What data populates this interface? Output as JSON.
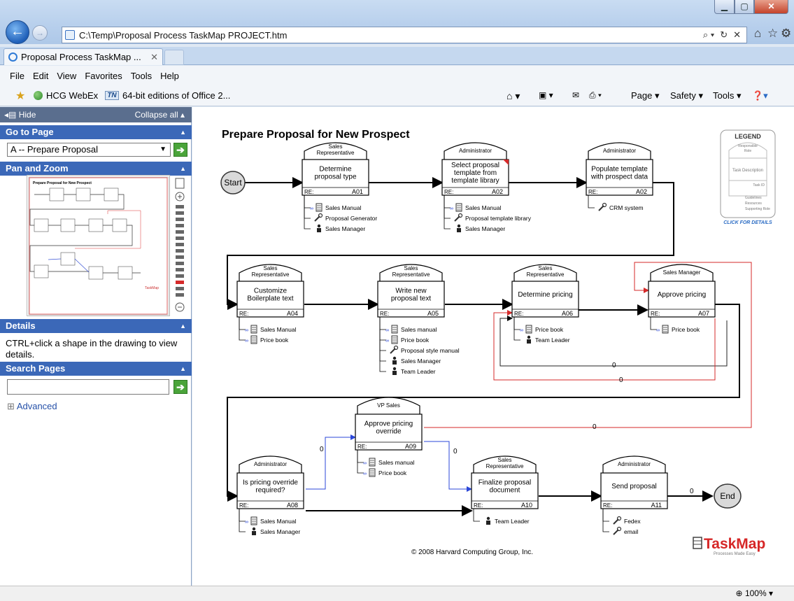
{
  "browser": {
    "address": "C:\\Temp\\Proposal Process TaskMap PROJECT.htm",
    "tab_title": "Proposal Process TaskMap ...",
    "tab_close": "✕",
    "menu": [
      "File",
      "Edit",
      "View",
      "Favorites",
      "Tools",
      "Help"
    ],
    "favorites": [
      "HCG WebEx",
      "64-bit editions of Office 2..."
    ],
    "commands": [
      "Page ▾",
      "Safety ▾",
      "Tools ▾"
    ],
    "zoom": "100%",
    "icons": [
      "back-icon",
      "forward-icon",
      "home-icon",
      "favorites-star-icon",
      "settings-gear-icon",
      "feeds-icon",
      "mail-icon",
      "print-icon",
      "help-icon"
    ]
  },
  "sidebar": {
    "hide": "Hide",
    "collapse_all": "Collapse all",
    "goto_header": "Go to Page",
    "goto_value": "A -- Prepare Proposal",
    "pan_zoom_header": "Pan and Zoom",
    "details_header": "Details",
    "details_text": "CTRL+click a shape in the drawing to view details.",
    "search_header": "Search Pages",
    "advanced": "Advanced"
  },
  "diagram": {
    "title": "Prepare Proposal for New Prospect",
    "start": "Start",
    "end": "End",
    "re_label": "RE:",
    "copyright": "© 2008 Harvard Computing Group, Inc.",
    "logo": "TaskMap",
    "logo_tag": "Processes Made Easy",
    "legend": {
      "title": "LEGEND",
      "role": [
        "Responsible",
        "Role"
      ],
      "desc": "Task Description",
      "id": "Task ID",
      "items": [
        "Guidelines",
        "Resources",
        "Supporting Role"
      ],
      "click": "CLICK FOR DETAILS"
    },
    "tasks": [
      {
        "id": "A01",
        "role": [
          "Sales",
          "Representative"
        ],
        "desc": [
          "Determine",
          "proposal type"
        ],
        "items": [
          [
            "doc",
            "Sales Manual"
          ],
          [
            "tool",
            "Proposal Generator"
          ],
          [
            "person",
            "Sales Manager"
          ]
        ]
      },
      {
        "id": "A02",
        "role": [
          "Administrator"
        ],
        "desc": [
          "Select proposal",
          "template from",
          "template library"
        ],
        "items": [
          [
            "doc",
            "Sales Manual"
          ],
          [
            "tool",
            "Proposal template library"
          ],
          [
            "person",
            "Sales Manager"
          ]
        ]
      },
      {
        "id": "A02",
        "role": [
          "Administrator"
        ],
        "desc": [
          "Populate template",
          "with prospect data"
        ],
        "items": [
          [
            "tool",
            "CRM system"
          ]
        ]
      },
      {
        "id": "A04",
        "role": [
          "Sales",
          "Representative"
        ],
        "desc": [
          "Customize",
          "Boilerplate text"
        ],
        "items": [
          [
            "doc",
            "Sales Manual"
          ],
          [
            "doc",
            "Price book"
          ]
        ]
      },
      {
        "id": "A05",
        "role": [
          "Sales",
          "Representative"
        ],
        "desc": [
          "Write new",
          "proposal text"
        ],
        "items": [
          [
            "doc",
            "Sales manual"
          ],
          [
            "doc",
            "Price book"
          ],
          [
            "tool",
            "Proposal style manual"
          ],
          [
            "person",
            "Sales Manager"
          ],
          [
            "person",
            "Team Leader"
          ]
        ]
      },
      {
        "id": "A06",
        "role": [
          "Sales",
          "Representative"
        ],
        "desc": [
          "Determine pricing"
        ],
        "items": [
          [
            "doc",
            "Price book"
          ],
          [
            "person",
            "Team Leader"
          ]
        ]
      },
      {
        "id": "A07",
        "role": [
          "Sales Manager"
        ],
        "desc": [
          "Approve pricing"
        ],
        "items": [
          [
            "doc",
            "Price book"
          ]
        ]
      },
      {
        "id": "A09",
        "role": [
          "VP Sales"
        ],
        "desc": [
          "Approve pricing",
          "override"
        ],
        "items": [
          [
            "doc",
            "Sales manual"
          ],
          [
            "doc",
            "Price book"
          ]
        ]
      },
      {
        "id": "A08",
        "role": [
          "Administrator"
        ],
        "desc": [
          "Is pricing override",
          "required?"
        ],
        "items": [
          [
            "doc",
            "Sales Manual"
          ],
          [
            "person",
            "Sales Manager"
          ]
        ]
      },
      {
        "id": "A10",
        "role": [
          "Sales",
          "Representative"
        ],
        "desc": [
          "Finalize proposal",
          "document"
        ],
        "items": [
          [
            "person",
            "Team Leader"
          ]
        ]
      },
      {
        "id": "A11",
        "role": [
          "Administrator"
        ],
        "desc": [
          "Send proposal"
        ],
        "items": [
          [
            "tool",
            "Fedex"
          ],
          [
            "tool",
            "email"
          ]
        ]
      }
    ],
    "edge_labels": [
      "0",
      "0",
      "0",
      "0",
      "0",
      "0"
    ]
  }
}
